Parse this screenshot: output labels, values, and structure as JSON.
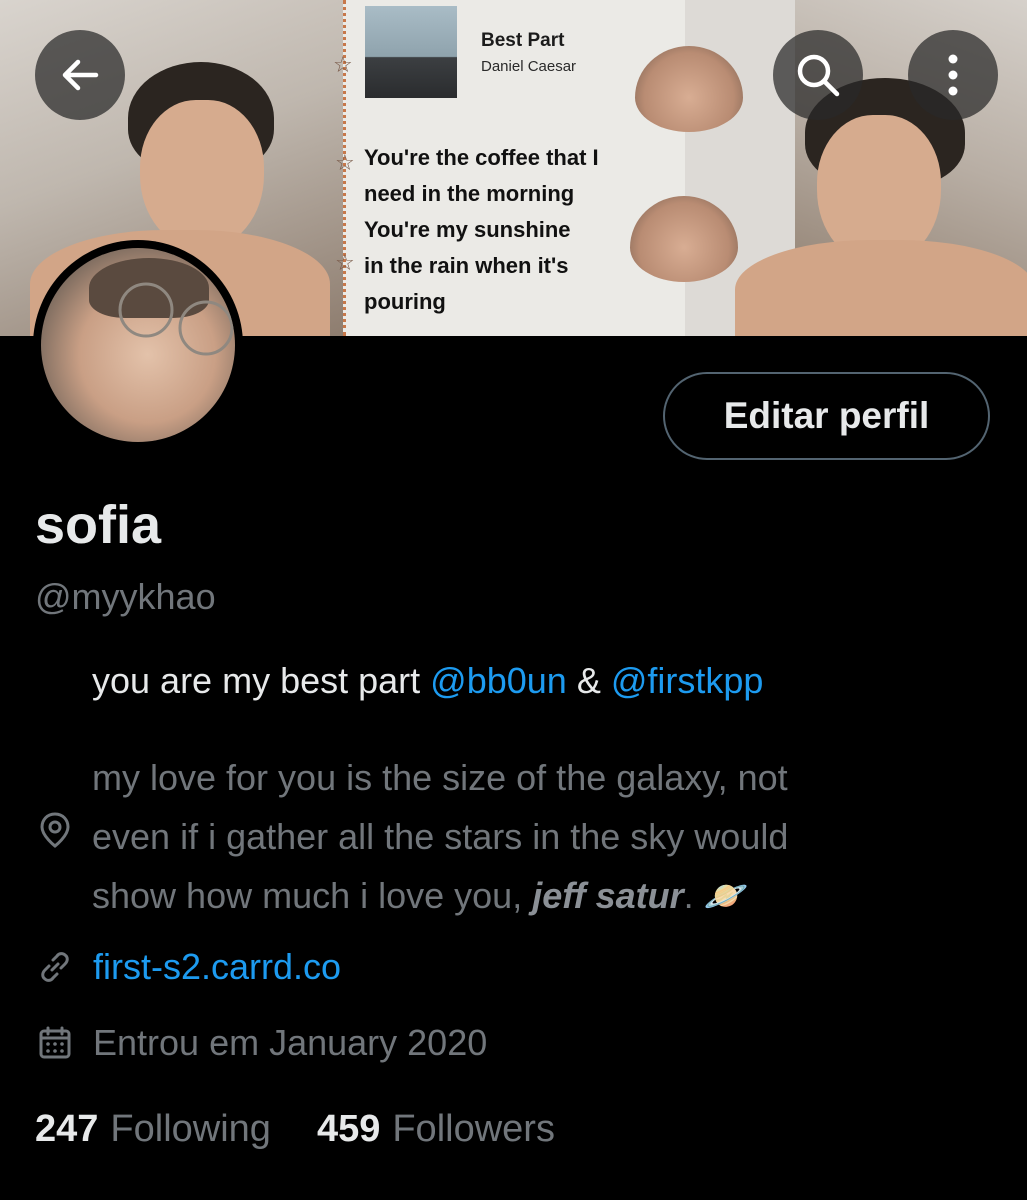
{
  "header": {
    "song": {
      "title": "Best Part",
      "artist": "Daniel Caesar"
    },
    "lyrics": [
      "You're the coffee that I",
      "need in the morning",
      "You're my sunshine",
      "in the rain when it's",
      "pouring"
    ],
    "buttons": {
      "back_icon": "arrow-left-icon",
      "search_icon": "search-icon",
      "more_icon": "more-vertical-icon"
    }
  },
  "profile": {
    "edit_label": "Editar perfil",
    "display_name": "sofia",
    "handle": "@myykhao",
    "bio": {
      "prefix": "you are my best part ",
      "mention1": "@bb0un",
      "joiner": " & ",
      "mention2": "@firstkpp"
    },
    "location_line1": "my love for you is the size of the galaxy, not",
    "location_line2": "even if i gather all the stars in the sky would",
    "location_line3_prefix": "show how much i love you, ",
    "location_line3_emph": "jeff satur",
    "location_line3_suffix": ". 🪐",
    "link": "first-s2.carrd.co",
    "joined": "Entrou em January 2020",
    "following_count": "247",
    "following_label": "Following",
    "followers_count": "459",
    "followers_label": "Followers"
  },
  "colors": {
    "background": "#000000",
    "accent": "#1d9bf0",
    "muted": "#71767b",
    "text": "#e7e9ea"
  }
}
